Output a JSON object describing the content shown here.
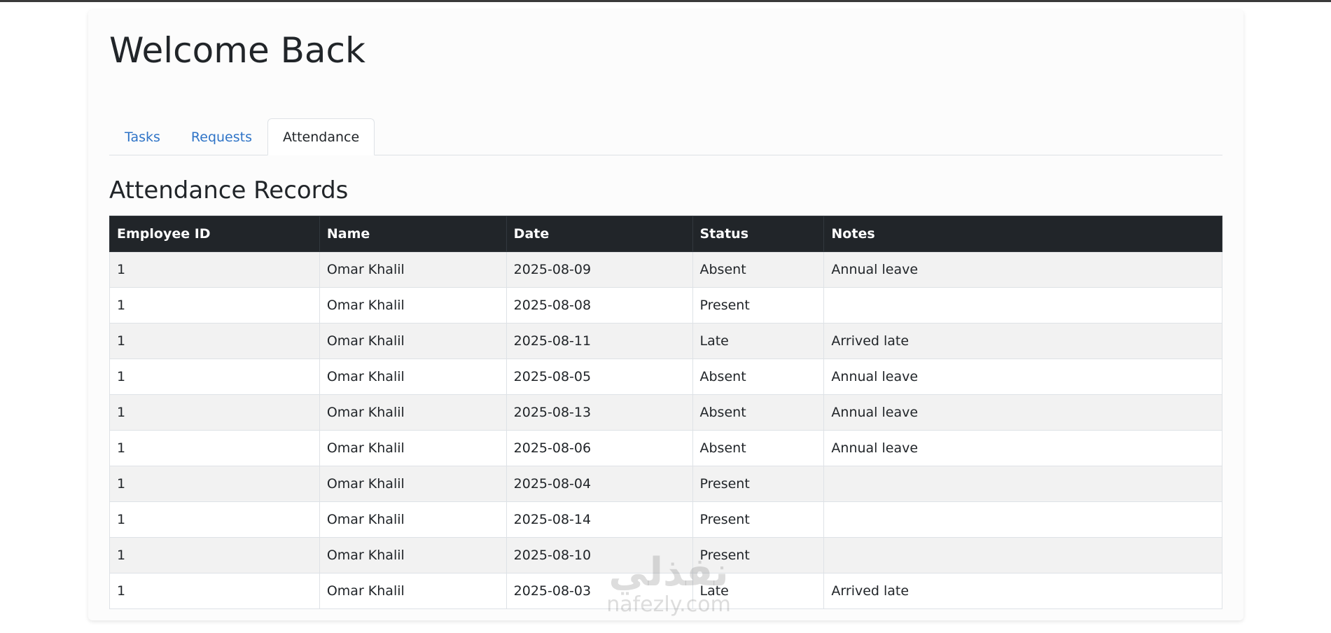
{
  "page": {
    "title": "Welcome Back"
  },
  "tabs": [
    {
      "label": "Tasks",
      "active": false
    },
    {
      "label": "Requests",
      "active": false
    },
    {
      "label": "Attendance",
      "active": true
    }
  ],
  "attendance": {
    "title": "Attendance Records",
    "columns": [
      "Employee ID",
      "Name",
      "Date",
      "Status",
      "Notes"
    ],
    "rows": [
      [
        "1",
        "Omar Khalil",
        "2025-08-09",
        "Absent",
        "Annual leave"
      ],
      [
        "1",
        "Omar Khalil",
        "2025-08-08",
        "Present",
        ""
      ],
      [
        "1",
        "Omar Khalil",
        "2025-08-11",
        "Late",
        "Arrived late"
      ],
      [
        "1",
        "Omar Khalil",
        "2025-08-05",
        "Absent",
        "Annual leave"
      ],
      [
        "1",
        "Omar Khalil",
        "2025-08-13",
        "Absent",
        "Annual leave"
      ],
      [
        "1",
        "Omar Khalil",
        "2025-08-06",
        "Absent",
        "Annual leave"
      ],
      [
        "1",
        "Omar Khalil",
        "2025-08-04",
        "Present",
        ""
      ],
      [
        "1",
        "Omar Khalil",
        "2025-08-14",
        "Present",
        ""
      ],
      [
        "1",
        "Omar Khalil",
        "2025-08-10",
        "Present",
        ""
      ],
      [
        "1",
        "Omar Khalil",
        "2025-08-03",
        "Late",
        "Arrived late"
      ]
    ]
  },
  "watermark": {
    "arabic": "نفذلي",
    "latin": "nafezly.com"
  },
  "colors": {
    "link": "#2f74c7",
    "header_bg": "#212529",
    "stripe": "#f2f2f2"
  }
}
